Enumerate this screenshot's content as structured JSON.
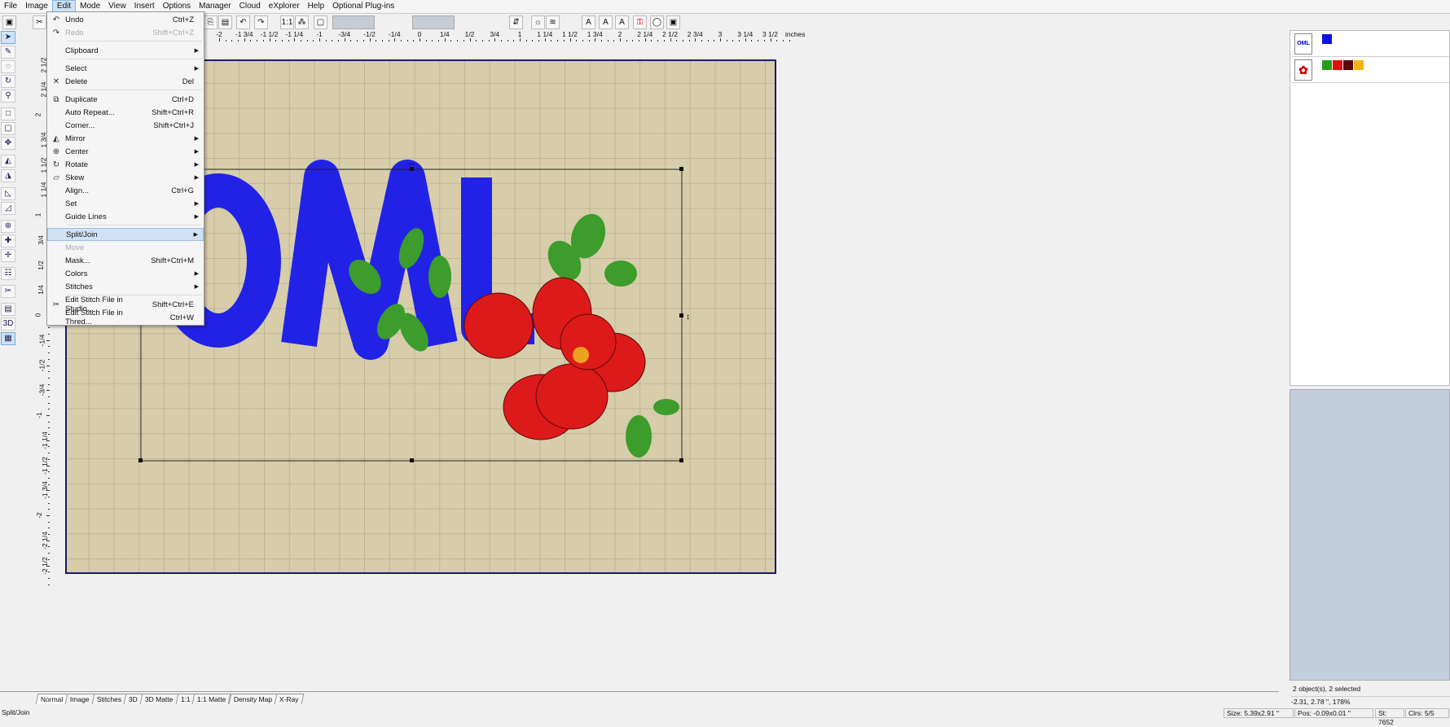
{
  "menubar": [
    "File",
    "Image",
    "Edit",
    "Mode",
    "View",
    "Insert",
    "Options",
    "Manager",
    "Cloud",
    "eXplorer",
    "Help",
    "Optional Plug-ins"
  ],
  "active_menu": "Edit",
  "edit_menu": [
    {
      "icon": "↶",
      "label": "Undo",
      "shortcut": "Ctrl+Z"
    },
    {
      "icon": "↷",
      "label": "Redo",
      "shortcut": "Shift+Ctrl+Z",
      "disabled": true,
      "sep_after": true
    },
    {
      "label": "Clipboard",
      "submenu": true,
      "sep_after": true
    },
    {
      "label": "Select",
      "submenu": true
    },
    {
      "icon": "✕",
      "label": "Delete",
      "shortcut": "Del",
      "sep_after": true
    },
    {
      "icon": "⧉",
      "label": "Duplicate",
      "shortcut": "Ctrl+D"
    },
    {
      "label": "Auto Repeat...",
      "shortcut": "Shift+Ctrl+R"
    },
    {
      "label": "Corner...",
      "shortcut": "Shift+Ctrl+J"
    },
    {
      "icon": "◭",
      "label": "Mirror",
      "submenu": true
    },
    {
      "icon": "⊕",
      "label": "Center",
      "submenu": true
    },
    {
      "icon": "↻",
      "label": "Rotate",
      "submenu": true
    },
    {
      "icon": "▱",
      "label": "Skew",
      "submenu": true
    },
    {
      "label": "Align...",
      "shortcut": "Ctrl+G"
    },
    {
      "label": "Set",
      "submenu": true
    },
    {
      "label": "Guide Lines",
      "submenu": true,
      "sep_after": true
    },
    {
      "label": "Split/Join",
      "submenu": true,
      "highlighted": true
    },
    {
      "label": "Move",
      "disabled": true
    },
    {
      "label": "Mask...",
      "shortcut": "Shift+Ctrl+M"
    },
    {
      "label": "Colors",
      "submenu": true
    },
    {
      "label": "Stitches",
      "submenu": true,
      "sep_after": true
    },
    {
      "icon": "✂",
      "label": "Edit Stitch File in Studio...",
      "shortcut": "Shift+Ctrl+E"
    },
    {
      "label": "Edit Stitch File in Thred...",
      "shortcut": "Ctrl+W"
    }
  ],
  "hruler": {
    "labels": [
      "-2",
      "-1 3/4",
      "-1 1/2",
      "-1 1/4",
      "-1",
      "-3/4",
      "-1/2",
      "-1/4",
      "0",
      "1/4",
      "1/2",
      "3/4",
      "1",
      "1 1/4",
      "1 1/2",
      "1 3/4",
      "2",
      "2 1/4",
      "2 1/2",
      "2 3/4",
      "3",
      "3 1/4",
      "3 1/2"
    ],
    "unit": "inches"
  },
  "vruler": {
    "labels": [
      "2 1/2",
      "2 1/4",
      "2",
      "1 3/4",
      "1 1/2",
      "1 1/4",
      "1",
      "3/4",
      "1/2",
      "1/4",
      "0",
      "-1/4",
      "-1/2",
      "-3/4",
      "-1",
      "-1 1/4",
      "-1 1/2",
      "-1 3/4",
      "-2",
      "-2 1/4",
      "-2 1/2"
    ]
  },
  "objects": [
    {
      "thumb": "OML",
      "colors": [
        "#1010e8"
      ]
    },
    {
      "thumb": "✿",
      "colors": [
        "#2a9a1a",
        "#e01010",
        "#5a0808",
        "#f4b418"
      ]
    }
  ],
  "view_tabs": [
    "Normal",
    "Image",
    "Stitches",
    "3D",
    "3D Matte",
    "1:1",
    "1:1 Matte",
    "Density Map",
    "X-Ray"
  ],
  "active_tab": "Normal",
  "selection_info": "2 object(s), 2 selected",
  "cursor_info": "-2.31, 2.78 \", 178%",
  "status": {
    "hint": "Split/Join",
    "size": "Size: 5.39x2.91 \"",
    "pos": "Pos: -0.09x0.01 \"",
    "stitches": "St: 7652",
    "colors": "Clrs: 5/5"
  },
  "design_colors": {
    "text": "#2222e6",
    "petal": "#dd1a1a",
    "leaf": "#3c9c2c",
    "center": "#f0a020"
  }
}
